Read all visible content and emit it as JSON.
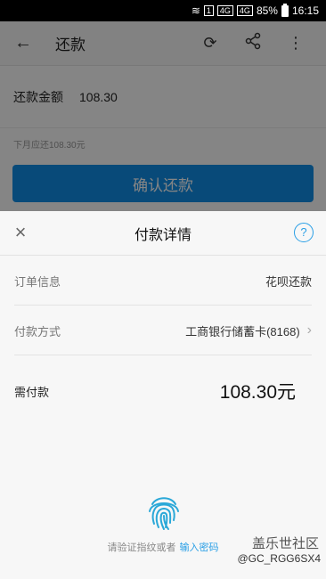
{
  "status_bar": {
    "net1": "4G",
    "net2": "4G",
    "battery": "85%",
    "time": "16:15"
  },
  "bg": {
    "title": "还款",
    "amount_label": "还款金额",
    "amount_value": "108.30",
    "next_month": "下月应还108.30元",
    "confirm": "确认还款"
  },
  "sheet": {
    "title": "付款详情",
    "help": "?",
    "rows": [
      {
        "label": "订单信息",
        "value": "花呗还款"
      },
      {
        "label": "付款方式",
        "value": "工商银行储蓄卡(8168)"
      }
    ],
    "pay_label": "需付款",
    "pay_value": "108.30元",
    "hint_text": "请验证指纹或者",
    "hint_link": "输入密码"
  },
  "watermark": {
    "line1": "盖乐世社区",
    "line2": "@GC_RGG6SX4"
  }
}
